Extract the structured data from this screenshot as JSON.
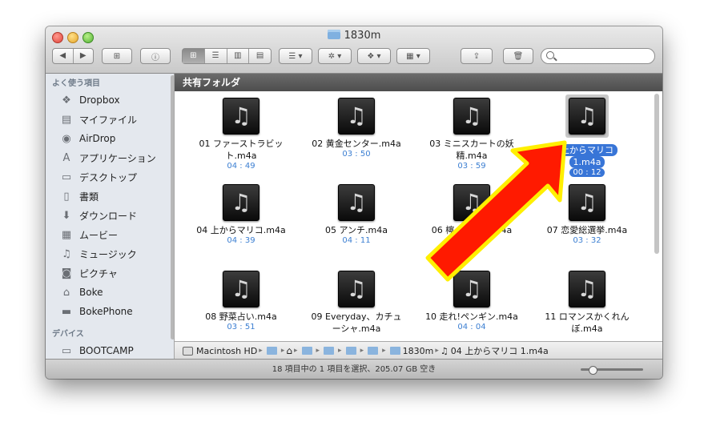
{
  "window": {
    "title": "1830m"
  },
  "toolbar": {
    "back_label": "◀",
    "forward_label": "▶",
    "new_folder_label": "⊞",
    "info_label": "ⓘ",
    "view_icon_label": "⊞",
    "view_list_label": "☰",
    "view_column_label": "▥",
    "view_coverflow_label": "▤",
    "arrange_label": "☰ ▾",
    "action_label": "✲ ▾",
    "dropbox_label": "❖ ▾",
    "more_label": "▦ ▾",
    "share_label": "⇪",
    "trash_label": "🗑",
    "search_placeholder": ""
  },
  "sidebar": {
    "favorites_header": "よく使う項目",
    "devices_header": "デバイス",
    "items": [
      {
        "label": "Dropbox",
        "icon": "❖"
      },
      {
        "label": "マイファイル",
        "icon": "▤"
      },
      {
        "label": "AirDrop",
        "icon": "◉"
      },
      {
        "label": "アプリケーション",
        "icon": "A"
      },
      {
        "label": "デスクトップ",
        "icon": "▭"
      },
      {
        "label": "書類",
        "icon": "▯"
      },
      {
        "label": "ダウンロード",
        "icon": "⬇"
      },
      {
        "label": "ムービー",
        "icon": "▦"
      },
      {
        "label": "ミュージック",
        "icon": "♫"
      },
      {
        "label": "ピクチャ",
        "icon": "◙"
      },
      {
        "label": "Boke",
        "icon": "⌂"
      },
      {
        "label": "BokePhone",
        "icon": "▬"
      }
    ],
    "devices": [
      {
        "label": "BOOTCAMP",
        "icon": "▭"
      }
    ]
  },
  "content": {
    "section_title": "共有フォルダ",
    "files": [
      {
        "name": "01 ファーストラビッ",
        "name2": "ト.m4a",
        "duration": "04 : 49",
        "selected": false
      },
      {
        "name": "02 黄金センター.m4a",
        "name2": "",
        "duration": "03 : 50",
        "selected": false
      },
      {
        "name": "03 ミニスカートの妖",
        "name2": "精.m4a",
        "duration": "03 : 59",
        "selected": false
      },
      {
        "name": "上からマリコ",
        "name2": "1.m4a",
        "duration": "00 : 12",
        "selected": true
      },
      {
        "name": "04 上からマリコ.m4a",
        "name2": "",
        "duration": "04 : 39",
        "selected": false
      },
      {
        "name": "05 アンチ.m4a",
        "name2": "",
        "duration": "04 : 11",
        "selected": false
      },
      {
        "name": "06 檸　　　貨.m4a",
        "name2": "",
        "duration": "00",
        "selected": false
      },
      {
        "name": "07 恋愛総選挙.m4a",
        "name2": "",
        "duration": "03 : 32",
        "selected": false
      },
      {
        "name": "08 野菜占い.m4a",
        "name2": "",
        "duration": "03 : 51",
        "selected": false
      },
      {
        "name": "09 Everyday、カチュ",
        "name2": "ーシャ.m4a",
        "duration": "",
        "selected": false
      },
      {
        "name": "10 走れ!ペンギン.m4a",
        "name2": "",
        "duration": "04 : 04",
        "selected": false
      },
      {
        "name": "11 ロマンスかくれん",
        "name2": "ぼ.m4a",
        "duration": "",
        "selected": false
      }
    ]
  },
  "pathbar": {
    "root": "Macintosh HD",
    "folder": "1830m",
    "file": "04 上からマリコ 1.m4a"
  },
  "status": {
    "text": "18 項目中の 1 項目を選択、205.07 GB 空き",
    "zoom_level": 0.15
  },
  "colors": {
    "selection": "#3875d7",
    "duration": "#3c7fd2",
    "arrow_fill": "#ff1a00",
    "arrow_outline": "#ffef00"
  }
}
